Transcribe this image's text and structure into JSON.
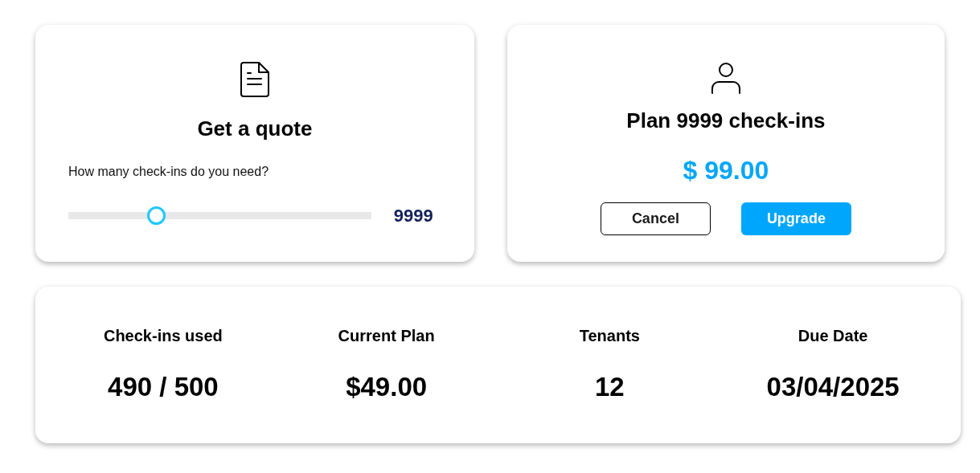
{
  "quote": {
    "title": "Get a quote",
    "question": "How many check-ins do you need?",
    "slider": {
      "level": 0.29
    },
    "value": "9999"
  },
  "plan": {
    "title": "Plan 9999 check-ins",
    "price": "$ 99.00",
    "buttons": [
      {
        "label": "Cancel",
        "kind": "outline"
      },
      {
        "label": "Upgrade",
        "kind": "primary"
      }
    ]
  },
  "stats": [
    {
      "label": "Check-ins used",
      "value": "490 / 500"
    },
    {
      "label": "Current Plan",
      "value": "$49.00"
    },
    {
      "label": "Tenants",
      "value": "12"
    },
    {
      "label": "Due Date",
      "value": "03/04/2025"
    }
  ]
}
